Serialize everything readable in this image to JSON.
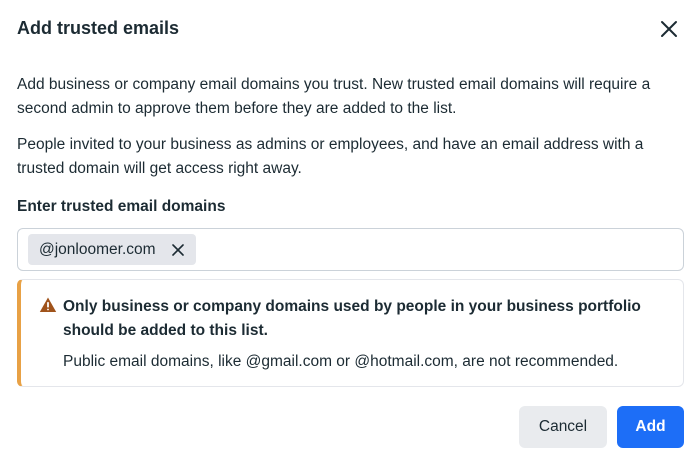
{
  "dialog": {
    "title": "Add trusted emails",
    "close_icon": "close-icon",
    "description": "Add business or company email domains you trust. New trusted email domains will require a second admin to approve them before they are added to the list.",
    "access_note": "People invited to your business as admins or employees, and have an email address with a trusted domain will get access right away."
  },
  "domains_field": {
    "label": "Enter trusted email domains",
    "chips": [
      {
        "value": "@jonloomer.com",
        "remove_icon": "remove-x-icon"
      }
    ]
  },
  "warning": {
    "icon": "warning-triangle-icon",
    "title": "Only business or company domains used by people in your business portfolio should be added to this list.",
    "text": "Public email domains, like @gmail.com or @hotmail.com, are not recommended.",
    "accent_color": "#e8a145"
  },
  "footer": {
    "cancel_label": "Cancel",
    "add_label": "Add",
    "primary_color": "#1d6ef7"
  }
}
